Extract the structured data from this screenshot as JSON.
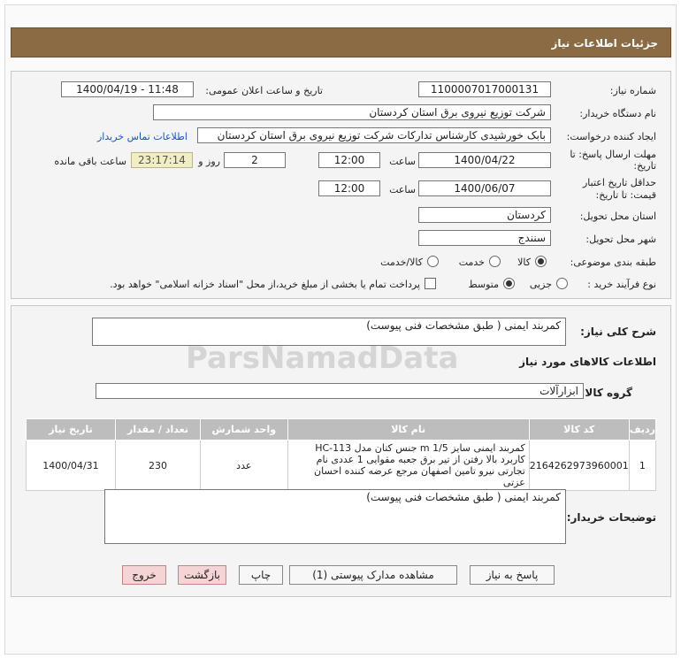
{
  "header": {
    "title": "جزئیات اطلاعات نیاز"
  },
  "form": {
    "need_number_label": "شماره نیاز:",
    "need_number": "1100007017000131",
    "announce_label": "تاریخ و ساعت اعلان عمومی:",
    "announce_value": "1400/04/19 - 11:48",
    "buyer_org_label": "نام دستگاه خریدار:",
    "buyer_org": "شرکت توزیع نیروی برق استان کردستان",
    "creator_label": "ایجاد کننده درخواست:",
    "creator": "بابک خورشیدی کارشناس تدارکات شرکت توزیع نیروی برق استان کردستان",
    "contact_link": "اطلاعات تماس خریدار",
    "reply_deadline_label_1": "مهلت ارسال پاسخ: تا",
    "reply_deadline_label_2": "تاریخ:",
    "reply_date": "1400/04/22",
    "time_label": "ساعت",
    "reply_time": "12:00",
    "days": "2",
    "days_label": "روز و",
    "remaining_time": "23:17:14",
    "remaining_label": "ساعت باقی مانده",
    "price_validity_label_1": "حداقل تاریخ اعتبار",
    "price_validity_label_2": "قیمت: تا تاریخ:",
    "validity_date": "1400/06/07",
    "validity_time": "12:00",
    "delivery_province_label": "استان محل تحویل:",
    "delivery_province": "کردستان",
    "delivery_city_label": "شهر محل تحویل:",
    "delivery_city": "سنندج",
    "category_label": "طبقه بندی موضوعی:",
    "category_options": [
      "کالا",
      "خدمت",
      "کالا/خدمت"
    ],
    "process_label": "نوع فرآیند خرید :",
    "process_options": [
      "جزیی",
      "متوسط"
    ],
    "payment_note": "پرداخت تمام یا بخشی از مبلغ خرید،از محل \"اسناد خزانه اسلامی\" خواهد بود."
  },
  "details": {
    "summary_label": "شرح کلی نیاز:",
    "summary": "کمربند ایمنی ( طبق مشخصات فنی پیوست)",
    "goods_info_title": "اطلاعات کالاهای مورد نیاز",
    "goods_group_label": "گروه کالا:",
    "goods_group": "ابزارآلات",
    "table_headers": [
      "ردیف",
      "کد کالا",
      "نام کالا",
      "واحد شمارش",
      "تعداد / مقدار",
      "تاریخ نیاز"
    ],
    "rows": [
      {
        "row": "1",
        "code": "2164262973960001",
        "name": "کمربند ایمنی سایز m 1/5 جنس کتان مدل HC-113 کاربرد بالا رفتن از تیر برق جعبه مقوایی 1 عددی نام تجارتی نیرو تامین اصفهان مرجع عرضه کننده احسان عزتی",
        "unit": "عدد",
        "qty": "230",
        "date": "1400/04/31"
      }
    ],
    "buyer_notes_label": "توضیحات خریدار:",
    "buyer_notes": "کمربند ایمنی ( طبق مشخصات فنی پیوست)"
  },
  "buttons": {
    "reply": "پاسخ به نیاز",
    "attachments": "مشاهده مدارک پیوستی (1)",
    "print": "چاپ",
    "back": "بازگشت",
    "exit": "خروج"
  },
  "watermark": {
    "text": "ParsNamadData"
  }
}
